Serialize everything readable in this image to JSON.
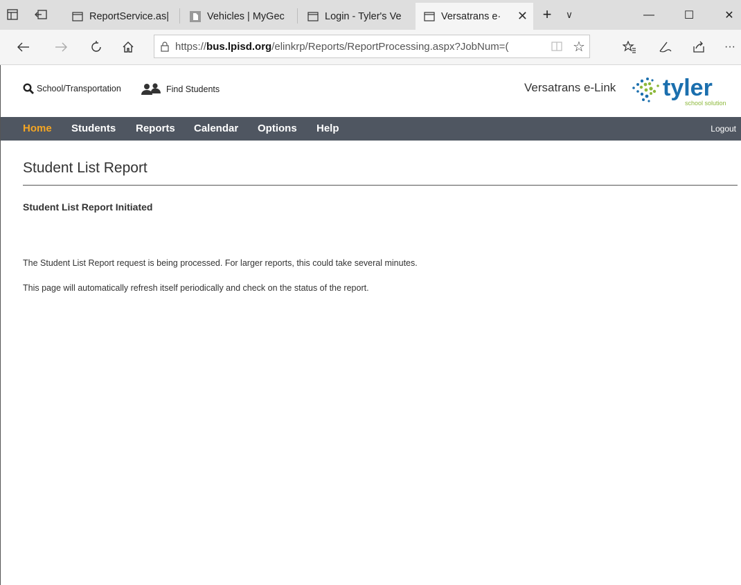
{
  "browser": {
    "tabs": [
      {
        "title": "ReportService.as|"
      },
      {
        "title": "Vehicles | MyGec"
      },
      {
        "title": "Login - Tyler's Ve"
      },
      {
        "title": "Versatrans e·"
      }
    ],
    "new_tab": "+",
    "tab_list": "∨",
    "close_tab": "✕",
    "window": {
      "minimize": "—",
      "maximize": "☐",
      "close": "✕"
    },
    "url": {
      "prefix": "https://",
      "domain": "bus.lpisd.org",
      "path": "/elinkrp/Reports/ReportProcessing.aspx?JobNum=("
    }
  },
  "app": {
    "header": {
      "school_transport_label": "School/Transportation",
      "find_students_label": "Find Students",
      "brand": "Versatrans e-Link",
      "logo_text": "tyler",
      "logo_sub": "school solution"
    },
    "menu": [
      "Home",
      "Students",
      "Reports",
      "Calendar",
      "Options",
      "Help"
    ],
    "active_menu": "Home",
    "logout": "Logout"
  },
  "content": {
    "title": "Student List Report",
    "status": "Student List Report Initiated",
    "message1": "The Student List Report request is being processed. For larger reports, this could take several minutes.",
    "message2": "This page will automatically refresh itself periodically and check on the status of the report."
  },
  "colors": {
    "menu_bg": "#4f5661",
    "menu_active": "#f5a623",
    "tyler_blue": "#1b6fae",
    "tyler_green": "#8cb83a"
  }
}
